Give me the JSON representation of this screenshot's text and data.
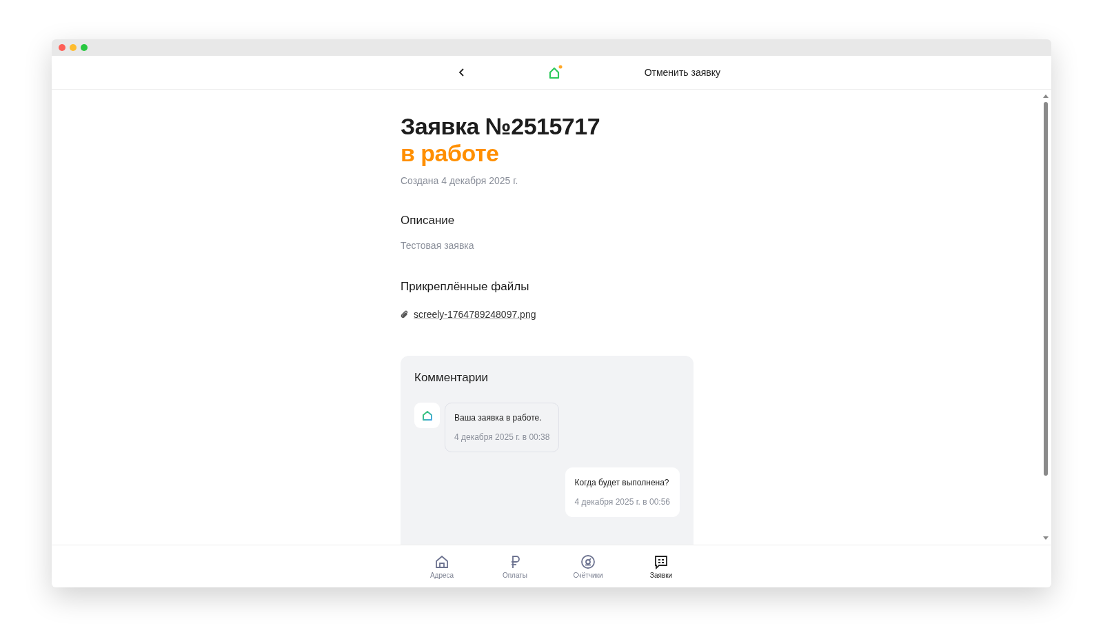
{
  "topbar": {
    "action": "Отменить заявку"
  },
  "ticket": {
    "title": "Заявка №2515717",
    "status": "в работе",
    "created": "Создана 4 декабря 2025 г.",
    "description_heading": "Описание",
    "description": "Тестовая заявка",
    "files_heading": "Прикреплённые файлы",
    "files": [
      {
        "name": "screely-1764789248097.png"
      }
    ]
  },
  "comments": {
    "title": "Комментарии",
    "items": [
      {
        "kind": "incoming",
        "text": "Ваша заявка в работе.",
        "time": "4 декабря 2025 г. в 00:38"
      },
      {
        "kind": "outgoing",
        "text": "Когда будет выполнена?",
        "time": "4 декабря 2025 г. в 00:56"
      }
    ]
  },
  "nav": [
    {
      "label": "Адреса",
      "selected": false
    },
    {
      "label": "Оплаты",
      "selected": false
    },
    {
      "label": "Счётчики",
      "selected": false
    },
    {
      "label": "Заявки",
      "selected": true
    }
  ]
}
